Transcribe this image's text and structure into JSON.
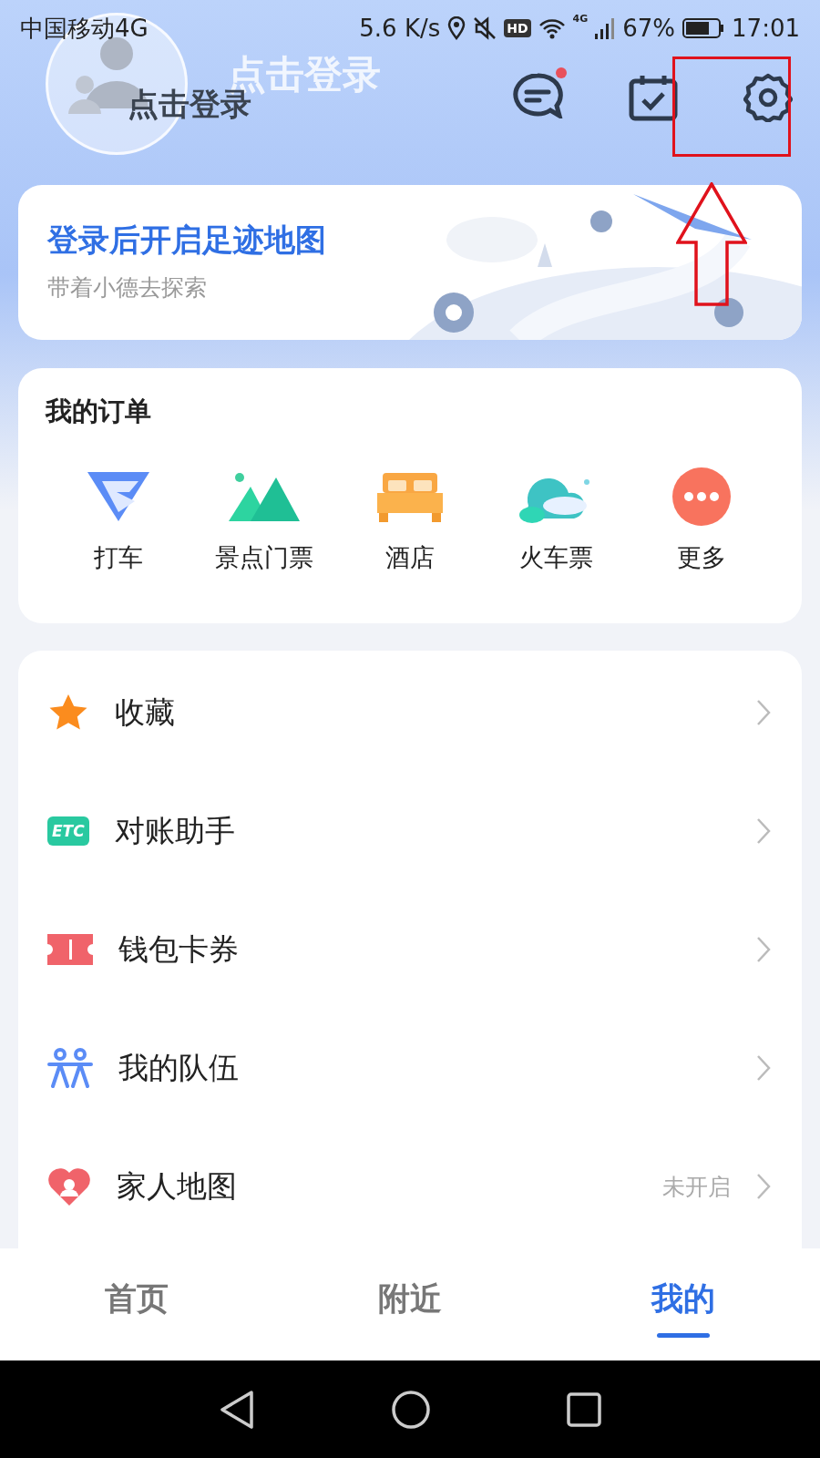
{
  "status_bar": {
    "carrier": "中国移动4G",
    "speed": "5.6 K/s",
    "hd": "HD",
    "network": "4G",
    "battery": "67%",
    "time": "17:01"
  },
  "header": {
    "ghost_title": "点击登录",
    "login": "点击登录",
    "messages_unread": true
  },
  "footprint_card": {
    "title": "登录后开启足迹地图",
    "subtitle": "带着小德去探索"
  },
  "orders": {
    "title": "我的订单",
    "items": [
      {
        "label": "打车",
        "kind": "taxi"
      },
      {
        "label": "景点门票",
        "kind": "scenic"
      },
      {
        "label": "酒店",
        "kind": "hotel"
      },
      {
        "label": "火车票",
        "kind": "train"
      },
      {
        "label": "更多",
        "kind": "more"
      }
    ]
  },
  "menu": [
    {
      "label": "收藏",
      "kind": "star"
    },
    {
      "label": "对账助手",
      "kind": "etc",
      "icon_text": "ETC"
    },
    {
      "label": "钱包卡券",
      "kind": "coupon"
    },
    {
      "label": "我的队伍",
      "kind": "team"
    },
    {
      "label": "家人地图",
      "kind": "family",
      "status": "未开启"
    }
  ],
  "bottom_nav": [
    {
      "label": "首页",
      "selected": false
    },
    {
      "label": "附近",
      "selected": false
    },
    {
      "label": "我的",
      "selected": true
    }
  ]
}
